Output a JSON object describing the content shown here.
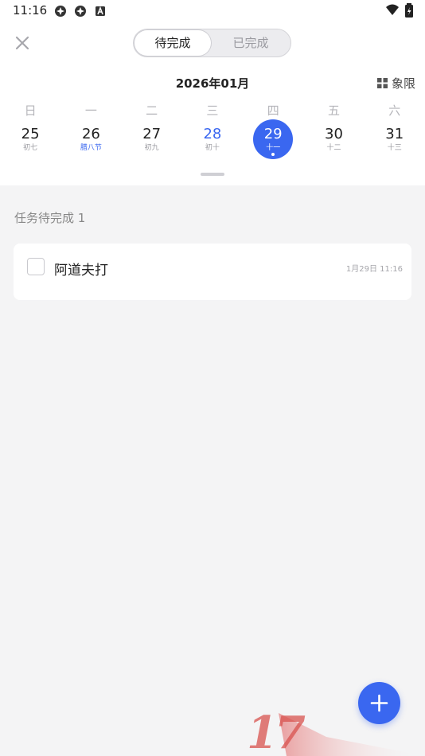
{
  "status_bar": {
    "time": "11:16"
  },
  "header": {
    "tabs": [
      {
        "label": "待完成",
        "active": true
      },
      {
        "label": "已完成",
        "active": false
      }
    ]
  },
  "calendar": {
    "month_title": "2026年01月",
    "view_button_label": "象限",
    "weekdays": [
      "日",
      "一",
      "二",
      "三",
      "四",
      "五",
      "六"
    ],
    "days": [
      {
        "num": "25",
        "lunar": "初七"
      },
      {
        "num": "26",
        "lunar": "腊八节"
      },
      {
        "num": "27",
        "lunar": "初九"
      },
      {
        "num": "28",
        "lunar": "初十"
      },
      {
        "num": "29",
        "lunar": "十一"
      },
      {
        "num": "30",
        "lunar": "十二"
      },
      {
        "num": "31",
        "lunar": "十三"
      }
    ]
  },
  "tasks": {
    "section_title": "任务待完成 1",
    "items": [
      {
        "title": "阿道夫打",
        "time": "1月29日 11:16",
        "done": false
      }
    ]
  },
  "watermark": {
    "text": "17"
  },
  "colors": {
    "accent": "#3a67f0",
    "background": "#f4f4f5"
  }
}
